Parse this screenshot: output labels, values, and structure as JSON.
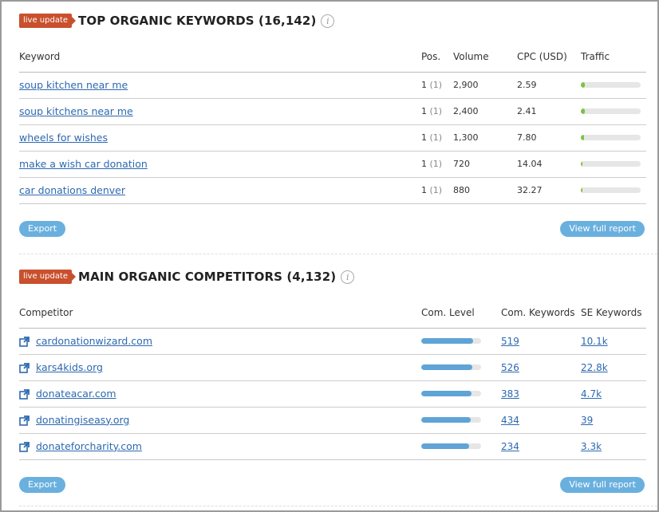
{
  "keywords_section": {
    "badge": "live update",
    "title": "TOP ORGANIC KEYWORDS",
    "count": "(16,142)",
    "columns": {
      "keyword": "Keyword",
      "pos": "Pos.",
      "volume": "Volume",
      "cpc": "CPC (USD)",
      "traffic": "Traffic"
    },
    "rows": [
      {
        "keyword": "soup kitchen near me",
        "pos": "1",
        "pos_prev": "(1)",
        "volume": "2,900",
        "cpc": "2.59",
        "traffic_fraction": 0.07
      },
      {
        "keyword": "soup kitchens near me",
        "pos": "1",
        "pos_prev": "(1)",
        "volume": "2,400",
        "cpc": "2.41",
        "traffic_fraction": 0.06
      },
      {
        "keyword": "wheels for wishes",
        "pos": "1",
        "pos_prev": "(1)",
        "volume": "1,300",
        "cpc": "7.80",
        "traffic_fraction": 0.05
      },
      {
        "keyword": "make a wish car donation",
        "pos": "1",
        "pos_prev": "(1)",
        "volume": "720",
        "cpc": "14.04",
        "traffic_fraction": 0.03
      },
      {
        "keyword": "car donations denver",
        "pos": "1",
        "pos_prev": "(1)",
        "volume": "880",
        "cpc": "32.27",
        "traffic_fraction": 0.02
      }
    ],
    "export_label": "Export",
    "report_label": "View full report"
  },
  "competitors_section": {
    "badge": "live update",
    "title": "MAIN ORGANIC COMPETITORS",
    "count": "(4,132)",
    "columns": {
      "competitor": "Competitor",
      "level": "Com. Level",
      "com_keywords": "Com. Keywords",
      "se_keywords": "SE Keywords"
    },
    "rows": [
      {
        "domain": "cardonationwizard.com",
        "level_fraction": 0.86,
        "com_keywords": "519",
        "se_keywords": "10.1k"
      },
      {
        "domain": "kars4kids.org",
        "level_fraction": 0.85,
        "com_keywords": "526",
        "se_keywords": "22.8k"
      },
      {
        "domain": "donateacar.com",
        "level_fraction": 0.84,
        "com_keywords": "383",
        "se_keywords": "4.7k"
      },
      {
        "domain": "donatingiseasy.org",
        "level_fraction": 0.82,
        "com_keywords": "434",
        "se_keywords": "39"
      },
      {
        "domain": "donateforcharity.com",
        "level_fraction": 0.8,
        "com_keywords": "234",
        "se_keywords": "3.3k"
      }
    ],
    "export_label": "Export",
    "report_label": "View full report"
  },
  "colors": {
    "badge": "#c9502d",
    "link": "#2d69b0",
    "traffic_bar": "#7cc242",
    "level_bar": "#5fa4d6",
    "button": "#6ab0df"
  },
  "icons": {
    "info": "info-icon",
    "external": "external-link-icon"
  }
}
